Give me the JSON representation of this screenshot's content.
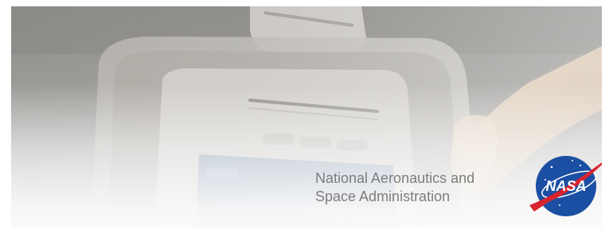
{
  "banner": {
    "org_line_1": "National Aeronautics and",
    "org_line_2": "Space Administration",
    "logo_text": "NASA",
    "logo_colors": {
      "globe": "#1b4fa3",
      "chevron": "#d9232e",
      "text": "#ffffff"
    },
    "text_color": "#7d7d7d"
  }
}
